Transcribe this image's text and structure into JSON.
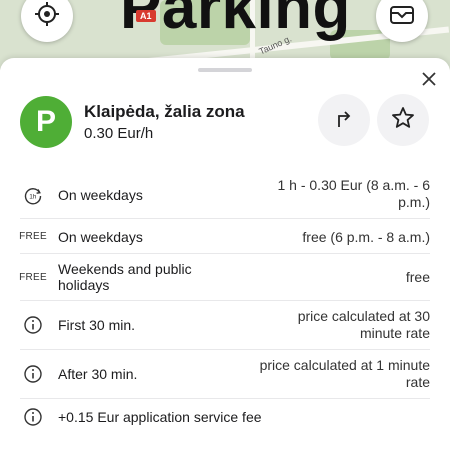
{
  "map": {
    "overlay_title": "Parking",
    "road_badge": "A1",
    "street_label": "Tauno g."
  },
  "icons": {
    "locate": "locate-crosshair-icon",
    "wallet": "wallet-icon",
    "close": "close-icon",
    "route": "route-arrow-icon",
    "favorite": "star-icon",
    "clock": "clock-1h-icon",
    "info": "info-icon"
  },
  "zone": {
    "badge": "P",
    "name": "Klaipėda, žalia zona",
    "price": "0.30 Eur/h",
    "badge_color": "#4fae36"
  },
  "rates": [
    {
      "icon": "clock",
      "label": "On weekdays",
      "value": "1 h - 0.30 Eur (8 a.m. - 6 p.m.)"
    },
    {
      "icon_text": "FREE",
      "label": "On weekdays",
      "value": "free (6 p.m. - 8 a.m.)"
    },
    {
      "icon_text": "FREE",
      "label": "Weekends and public holidays",
      "value": "free"
    },
    {
      "icon": "info",
      "label": "First 30 min.",
      "value": "price calculated at 30 minute rate"
    },
    {
      "icon": "info",
      "label": "After 30 min.",
      "value": "price calculated at 1 minute rate"
    },
    {
      "icon": "info",
      "label": "+0.15 Eur application service fee",
      "value": ""
    }
  ]
}
